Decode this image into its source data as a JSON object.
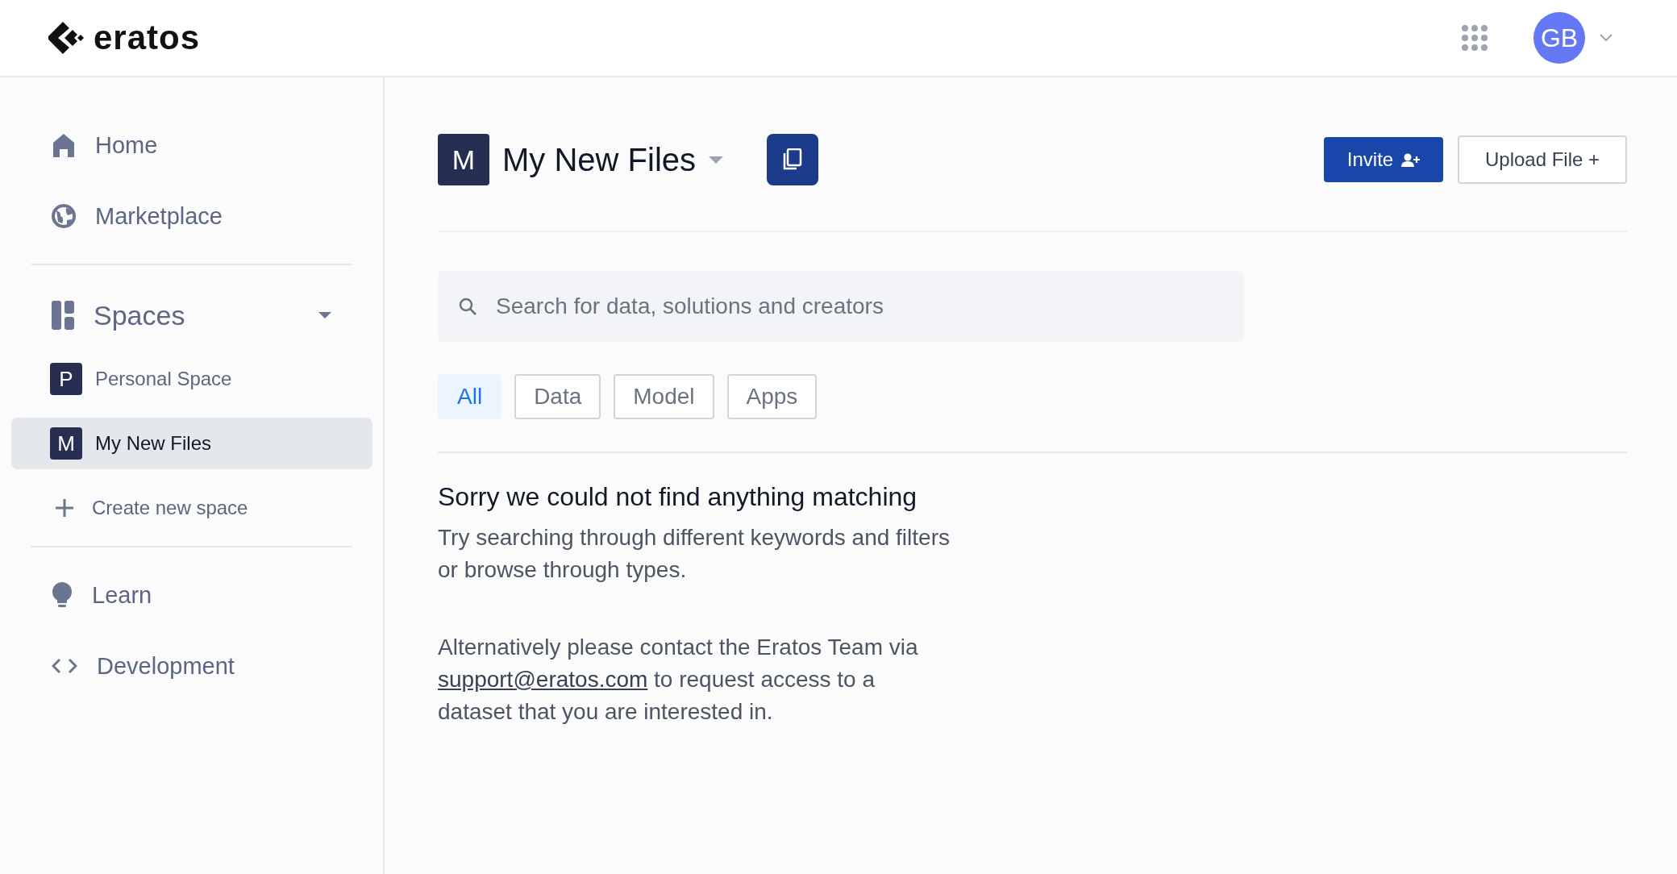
{
  "header": {
    "logo_text": "eratos",
    "avatar": "GB"
  },
  "sidebar": {
    "top_nav": [
      {
        "kind": "home",
        "label": "Home"
      },
      {
        "kind": "globe",
        "label": "Marketplace"
      }
    ],
    "spaces_section": {
      "label": "Spaces",
      "expanded": true
    },
    "spaces": [
      {
        "initial": "P",
        "label": "Personal Space",
        "selected": false
      },
      {
        "initial": "M",
        "label": "My New Files",
        "selected": true
      }
    ],
    "create_space": "Create new space",
    "bottom_nav": [
      {
        "kind": "bulb",
        "label": "Learn"
      },
      {
        "kind": "code",
        "label": "Development"
      }
    ]
  },
  "main": {
    "space": {
      "initial": "M",
      "title": "My New Files"
    },
    "buttons": {
      "invite": "Invite",
      "upload": "Upload File +"
    },
    "search": {
      "placeholder": "Search for data, solutions and creators"
    },
    "filters": [
      {
        "label": "All",
        "selected": true
      },
      {
        "label": "Data",
        "selected": false
      },
      {
        "label": "Model",
        "selected": false
      },
      {
        "label": "Apps",
        "selected": false
      }
    ],
    "empty_state": {
      "heading": "Sorry we could not find anything matching",
      "message": "Try searching through different keywords and filters or browse through types.",
      "contact_before": "Alternatively please contact the Eratos Team via",
      "contact_link": "support@eratos.com",
      "contact_after": "to request access to a dataset that you are interested in."
    }
  }
}
